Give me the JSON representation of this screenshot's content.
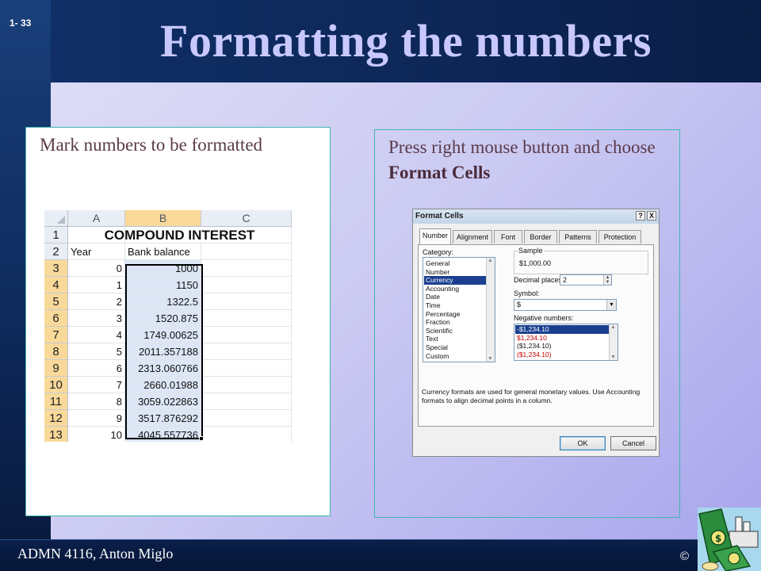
{
  "slide": {
    "number": "1- 33",
    "title": "Formatting the numbers",
    "footer": "ADMN 4116, Anton Miglo",
    "copyright": "©"
  },
  "left_panel": {
    "caption": "Mark numbers to be formatted"
  },
  "right_panel": {
    "caption_prefix": "Press right mouse button and choose ",
    "caption_bold": "Format Cells"
  },
  "spreadsheet": {
    "columns": [
      "A",
      "B",
      "C"
    ],
    "rows": [
      "1",
      "2",
      "3",
      "4",
      "5",
      "6",
      "7",
      "8",
      "9",
      "10",
      "11",
      "12",
      "13"
    ],
    "title": "COMPOUND INTEREST",
    "headers": [
      "Year",
      "Bank balance"
    ],
    "data": [
      [
        "0",
        "1000"
      ],
      [
        "1",
        "1150"
      ],
      [
        "2",
        "1322.5"
      ],
      [
        "3",
        "1520.875"
      ],
      [
        "4",
        "1749.00625"
      ],
      [
        "5",
        "2011.357188"
      ],
      [
        "6",
        "2313.060766"
      ],
      [
        "7",
        "2660.01988"
      ],
      [
        "8",
        "3059.022863"
      ],
      [
        "9",
        "3517.876292"
      ],
      [
        "10",
        "4045.557736"
      ]
    ]
  },
  "dialog": {
    "title": "Format Cells",
    "help_btn": "?",
    "close_btn": "X",
    "tabs": [
      "Number",
      "Alignment",
      "Font",
      "Border",
      "Patterns",
      "Protection"
    ],
    "category_label": "Category:",
    "categories": [
      "General",
      "Number",
      "Currency",
      "Accounting",
      "Date",
      "Time",
      "Percentage",
      "Fraction",
      "Scientific",
      "Text",
      "Special",
      "Custom"
    ],
    "selected_category": "Currency",
    "sample_label": "Sample",
    "sample_value": "$1,000.00",
    "decimal_label": "Decimal places:",
    "decimal_value": "2",
    "symbol_label": "Symbol:",
    "symbol_value": "$",
    "negative_label": "Negative numbers:",
    "negative_options": [
      "-$1,234.10",
      "$1,234.10",
      "($1,234.10)",
      "($1,234.10)"
    ],
    "description": "Currency formats are used for general monetary values.  Use Accounting formats to align decimal points in a column.",
    "ok": "OK",
    "cancel": "Cancel"
  }
}
